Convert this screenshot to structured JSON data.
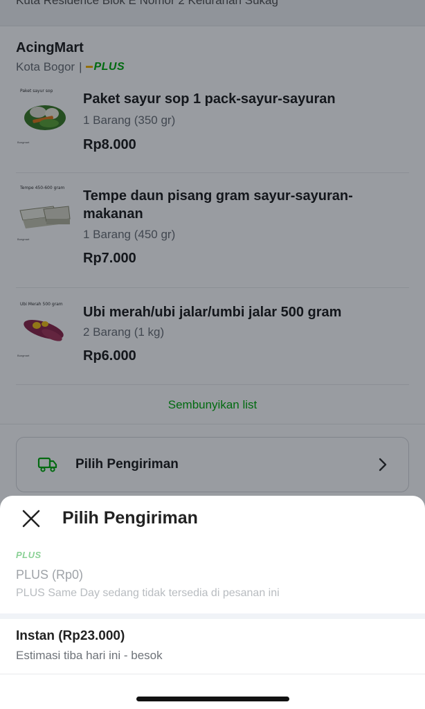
{
  "header": {
    "address_partial": "Kuta Residence Blok E Nomor 2 Kelurahan Sukag"
  },
  "store": {
    "name": "AcingMart",
    "city": "Kota Bogor",
    "separator": "|",
    "badge": "PLUS"
  },
  "products": [
    {
      "thumb_caption": "Paket sayur sop",
      "thumb_footer": "Bungmart",
      "title": "Paket sayur sop 1 pack-sayur-sayuran",
      "qty": "1 Barang (350 gr)",
      "price": "Rp8.000"
    },
    {
      "thumb_caption": "Tempe 450-600 gram",
      "thumb_footer": "Bungmart",
      "title": "Tempe daun pisang gram sayur-sayuran-makanan",
      "qty": "1 Barang (450 gr)",
      "price": "Rp7.000"
    },
    {
      "thumb_caption": "Ubi Merah 500 gram",
      "thumb_footer": "Bungmart",
      "title": "Ubi merah/ubi jalar/umbi jalar 500 gram",
      "qty": "2 Barang (1 kg)",
      "price": "Rp6.000"
    }
  ],
  "hide_list": "Sembunyikan list",
  "shipping_card": {
    "label": "Pilih Pengiriman",
    "icon": "truck-icon"
  },
  "sheet": {
    "title": "Pilih Pengiriman",
    "options": [
      {
        "badge": "PLUS",
        "name": "PLUS (Rp0)",
        "desc": "PLUS Same Day sedang tidak tersedia di pesanan ini",
        "enabled": false
      },
      {
        "name": "Instan (Rp23.000)",
        "desc": "Estimasi tiba hari ini - besok",
        "enabled": true
      }
    ]
  },
  "colors": {
    "accent": "#03ac0e",
    "plus_stripe": "#f7b500",
    "overlay": "rgba(0,7,20,0.40)"
  }
}
